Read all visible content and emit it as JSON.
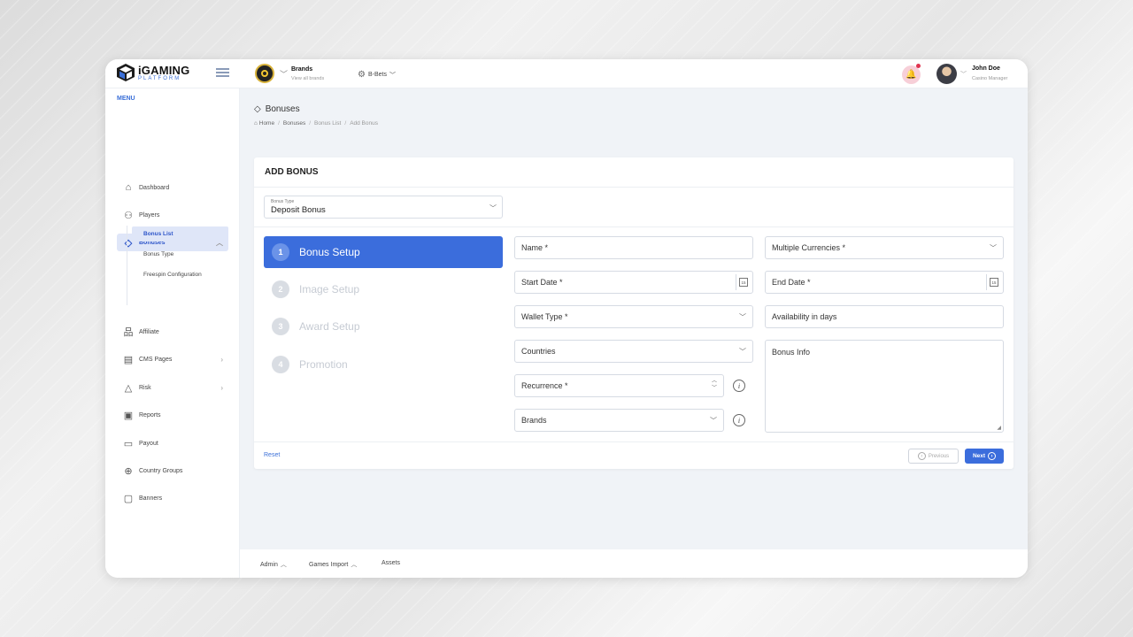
{
  "topbar": {
    "logo_main": "iGAMING",
    "logo_sub": "PLATFORM",
    "brands_title": "Brands",
    "brands_sub": "View all brands",
    "site_name": "B-Bets",
    "user_name": "John Doe",
    "user_role": "Casino Manager"
  },
  "sidebar": {
    "menu_heading": "MENU",
    "items": [
      {
        "label": "Dashboard",
        "icon": "home-icon"
      },
      {
        "label": "Players",
        "icon": "players-icon"
      },
      {
        "label": "Bonuses",
        "icon": "diamond-icon"
      },
      {
        "label": "Affiliate",
        "icon": "sitemap-icon"
      },
      {
        "label": "CMS Pages",
        "icon": "cms-icon"
      },
      {
        "label": "Risk",
        "icon": "warning-icon"
      },
      {
        "label": "Reports",
        "icon": "reports-icon"
      },
      {
        "label": "Payout",
        "icon": "payout-icon"
      },
      {
        "label": "Country Groups",
        "icon": "globe-icon"
      },
      {
        "label": "Banners",
        "icon": "banner-icon"
      }
    ],
    "sub_items": [
      "Bonus List",
      "Bonus Type",
      "Freespin Configuration"
    ]
  },
  "page": {
    "title": "Bonuses",
    "breadcrumb": [
      "Home",
      "Bonuses",
      "Bonus List",
      "Add Bonus"
    ]
  },
  "card": {
    "heading": "ADD BONUS",
    "bonus_type_label": "Bonus Type",
    "bonus_type_value": "Deposit Bonus",
    "steps": [
      {
        "num": "1",
        "label": "Bonus Setup"
      },
      {
        "num": "2",
        "label": "Image Setup"
      },
      {
        "num": "3",
        "label": "Award Setup"
      },
      {
        "num": "4",
        "label": "Promotion"
      }
    ],
    "fields": {
      "name": "Name *",
      "currencies": "Multiple Currencies *",
      "start_date": "Start Date *",
      "end_date": "End Date *",
      "wallet_type": "Wallet Type *",
      "availability": "Availability in days",
      "countries": "Countries",
      "bonus_info": "Bonus Info",
      "recurrence": "Recurrence *",
      "brands": "Brands"
    },
    "calendar_day": "15",
    "reset": "Reset",
    "previous": "Previous",
    "next": "Next"
  },
  "footer": {
    "items": [
      "Admin",
      "Games Import",
      "Assets"
    ]
  },
  "colors": {
    "accent": "#3b6ddc",
    "active_bg": "#dfe6f8",
    "notification": "#e0344f"
  }
}
